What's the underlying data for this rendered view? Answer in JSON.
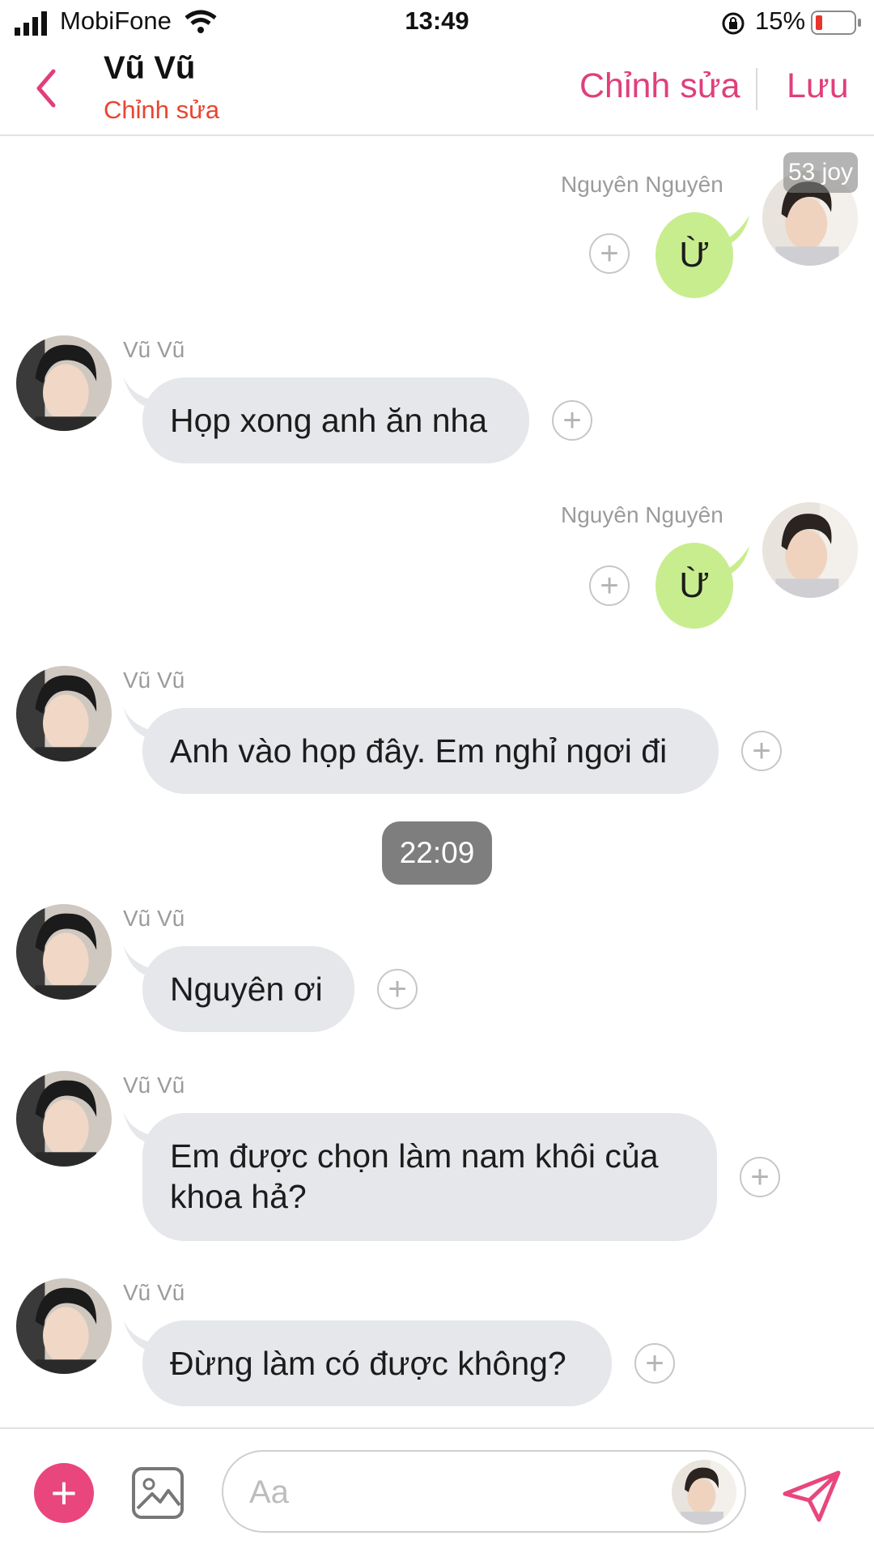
{
  "status_bar": {
    "carrier": "MobiFone",
    "time": "13:49",
    "battery": "15%"
  },
  "header": {
    "contact_name": "Vũ Vũ",
    "contact_subtitle": "Chỉnh sửa",
    "edit_label": "Chỉnh sửa",
    "save_label": "Lưu",
    "accent_color": "#e03f7c"
  },
  "chat": {
    "badge": "53 joy",
    "messages": [
      {
        "sender": "Nguyên Nguyên",
        "text": "Ừ",
        "side": "right"
      },
      {
        "sender": "Vũ Vũ",
        "text": "Họp xong anh ăn nha",
        "side": "left"
      },
      {
        "sender": "Nguyên Nguyên",
        "text": "Ừ",
        "side": "right"
      },
      {
        "sender": "Vũ Vũ",
        "text": "Anh vào họp đây. Em nghỉ ngơi đi",
        "side": "left"
      },
      {
        "sender": "Vũ Vũ",
        "text": "Nguyên ơi",
        "side": "left"
      },
      {
        "sender": "Vũ Vũ",
        "text": "Em được chọn làm nam khôi của khoa hả?",
        "side": "left"
      },
      {
        "sender": "Vũ Vũ",
        "text": "Đừng làm có được không?",
        "side": "left"
      }
    ],
    "timestamp": "22:09",
    "plus_symbol": "+"
  },
  "bottom_bar": {
    "add_symbol": "+",
    "input_placeholder": "Aa",
    "icons": [
      "add-icon",
      "image-icon",
      "avatar-icon",
      "send-icon"
    ]
  }
}
